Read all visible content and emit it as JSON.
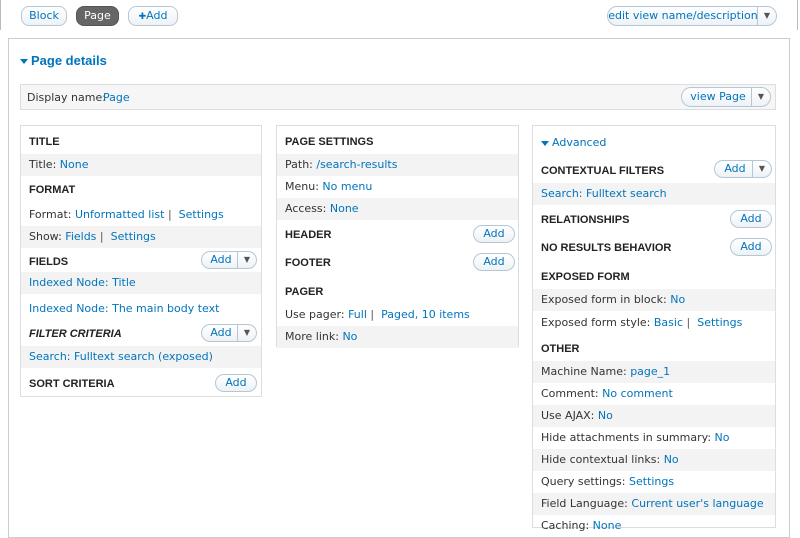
{
  "topbar": {
    "tabs": [
      "Block",
      "Page"
    ],
    "add_label": "Add",
    "add_icon": "✚",
    "edit_view_label": "edit view name/description"
  },
  "page_details": {
    "title": "Page details",
    "display_name_label": "Display name:",
    "display_name_value": "Page",
    "view_page_label": "view Page"
  },
  "col1": {
    "title_header": "TITLE",
    "title_label": "Title:",
    "title_value": "None",
    "format_header": "FORMAT",
    "format_label": "Format:",
    "format_value": "Unformatted list",
    "format_settings": "Settings",
    "show_label": "Show:",
    "show_value": "Fields",
    "show_settings": "Settings",
    "fields_header": "FIELDS",
    "fields_add": "Add",
    "field_items": [
      "Indexed Node: Title",
      "Indexed Node: The main body text"
    ],
    "filter_header": "FILTER CRITERIA",
    "filter_add": "Add",
    "filter_item": "Search: Fulltext search (exposed)",
    "sort_header": "SORT CRITERIA",
    "sort_add": "Add"
  },
  "col2": {
    "page_settings_header": "PAGE SETTINGS",
    "path_label": "Path:",
    "path_value": "/search-results",
    "menu_label": "Menu:",
    "menu_value": "No menu",
    "access_label": "Access:",
    "access_value": "None",
    "header_header": "HEADER",
    "header_add": "Add",
    "footer_header": "FOOTER",
    "footer_add": "Add",
    "pager_header": "PAGER",
    "use_pager_label": "Use pager:",
    "use_pager_value": "Full",
    "use_pager_value2": "Paged, 10 items",
    "more_link_label": "More link:",
    "more_link_value": "No"
  },
  "col3": {
    "advanced_label": "Advanced",
    "contextual_header": "CONTEXTUAL FILTERS",
    "contextual_add": "Add",
    "contextual_item": "Search: Fulltext search",
    "relationships_header": "RELATIONSHIPS",
    "relationships_add": "Add",
    "no_results_header": "NO RESULTS BEHAVIOR",
    "no_results_add": "Add",
    "exposed_header": "EXPOSED FORM",
    "exposed_block_label": "Exposed form in block:",
    "exposed_block_value": "No",
    "exposed_style_label": "Exposed form style:",
    "exposed_style_value": "Basic",
    "exposed_style_settings": "Settings",
    "other_header": "OTHER",
    "machine_label": "Machine Name:",
    "machine_value": "page_1",
    "comment_label": "Comment:",
    "comment_value": "No comment",
    "ajax_label": "Use AJAX:",
    "ajax_value": "No",
    "hide_attach_label": "Hide attachments in summary:",
    "hide_attach_value": "No",
    "hide_ctx_label": "Hide contextual links:",
    "hide_ctx_value": "No",
    "query_label": "Query settings:",
    "query_value": "Settings",
    "lang_label": "Field Language:",
    "lang_value": "Current user's language",
    "caching_label": "Caching:",
    "caching_value": "None"
  },
  "colors": {
    "link": "#0074bd",
    "active_tab": "#666666"
  }
}
